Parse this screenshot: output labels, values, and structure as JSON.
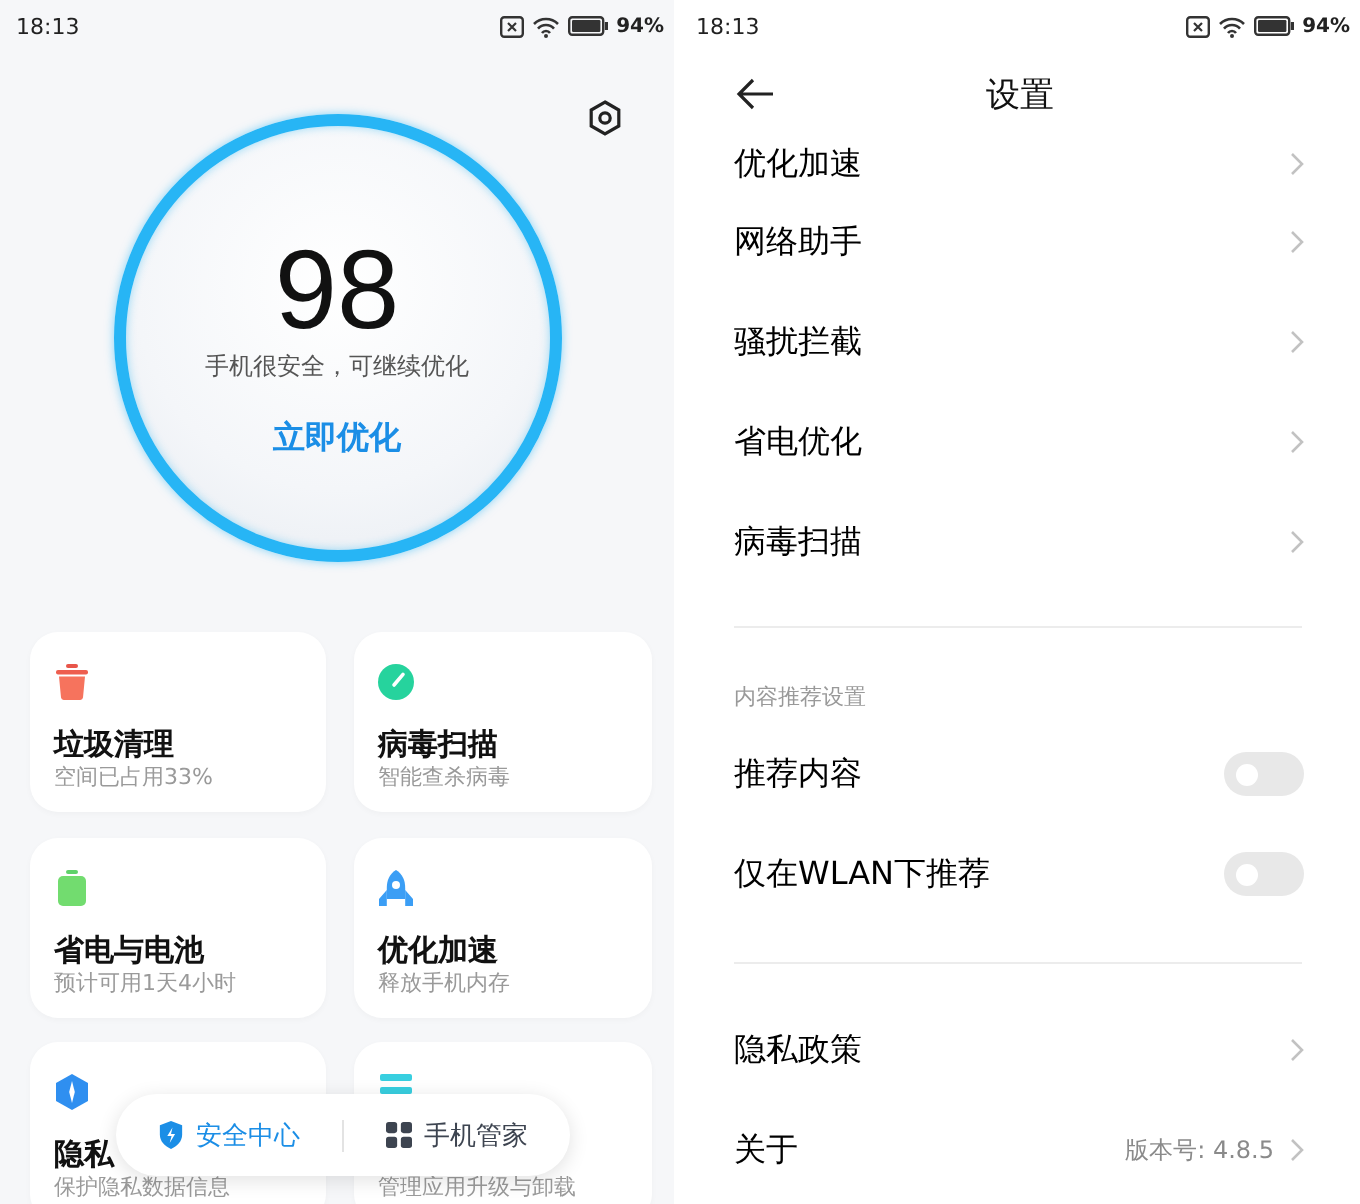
{
  "home": {
    "status_bar": {
      "time": "18:13",
      "battery": "94%"
    },
    "score": {
      "value": "98",
      "message": "手机很安全，可继续优化",
      "action": "立即优化"
    },
    "cards": [
      {
        "kind": "cleanup",
        "title": "垃圾清理",
        "subtitle": "空间已占用33%"
      },
      {
        "kind": "scan",
        "title": "病毒扫描",
        "subtitle": "智能查杀病毒"
      },
      {
        "kind": "battery",
        "title": "省电与电池",
        "subtitle": "预计可用1天4小时"
      },
      {
        "kind": "boost",
        "title": "优化加速",
        "subtitle": "释放手机内存"
      },
      {
        "kind": "privacy",
        "title": "隐私",
        "subtitle": "保护隐私数据信息"
      },
      {
        "kind": "apps",
        "subtitle": "管理应用升级与卸载"
      }
    ],
    "bottom_nav": [
      {
        "kind": "security",
        "label": "安全中心",
        "selected": true
      },
      {
        "kind": "manager",
        "label": "手机管家",
        "selected": false
      }
    ]
  },
  "settings": {
    "status_bar": {
      "time": "18:13",
      "battery": "94%"
    },
    "title": "设置",
    "sections": [
      {
        "items": [
          {
            "kind": "link",
            "label": "优化加速"
          },
          {
            "kind": "link",
            "label": "网络助手"
          },
          {
            "kind": "link",
            "label": "骚扰拦截"
          },
          {
            "kind": "link",
            "label": "省电优化"
          },
          {
            "kind": "link",
            "label": "病毒扫描"
          }
        ]
      },
      {
        "header": "内容推荐设置",
        "items": [
          {
            "kind": "toggle",
            "label": "推荐内容",
            "on": false
          },
          {
            "kind": "toggle",
            "label": "仅在WLAN下推荐",
            "on": false
          }
        ]
      },
      {
        "items": [
          {
            "kind": "link",
            "label": "隐私政策"
          },
          {
            "kind": "link",
            "label": "关于",
            "value": "版本号: 4.8.5"
          }
        ]
      }
    ]
  }
}
